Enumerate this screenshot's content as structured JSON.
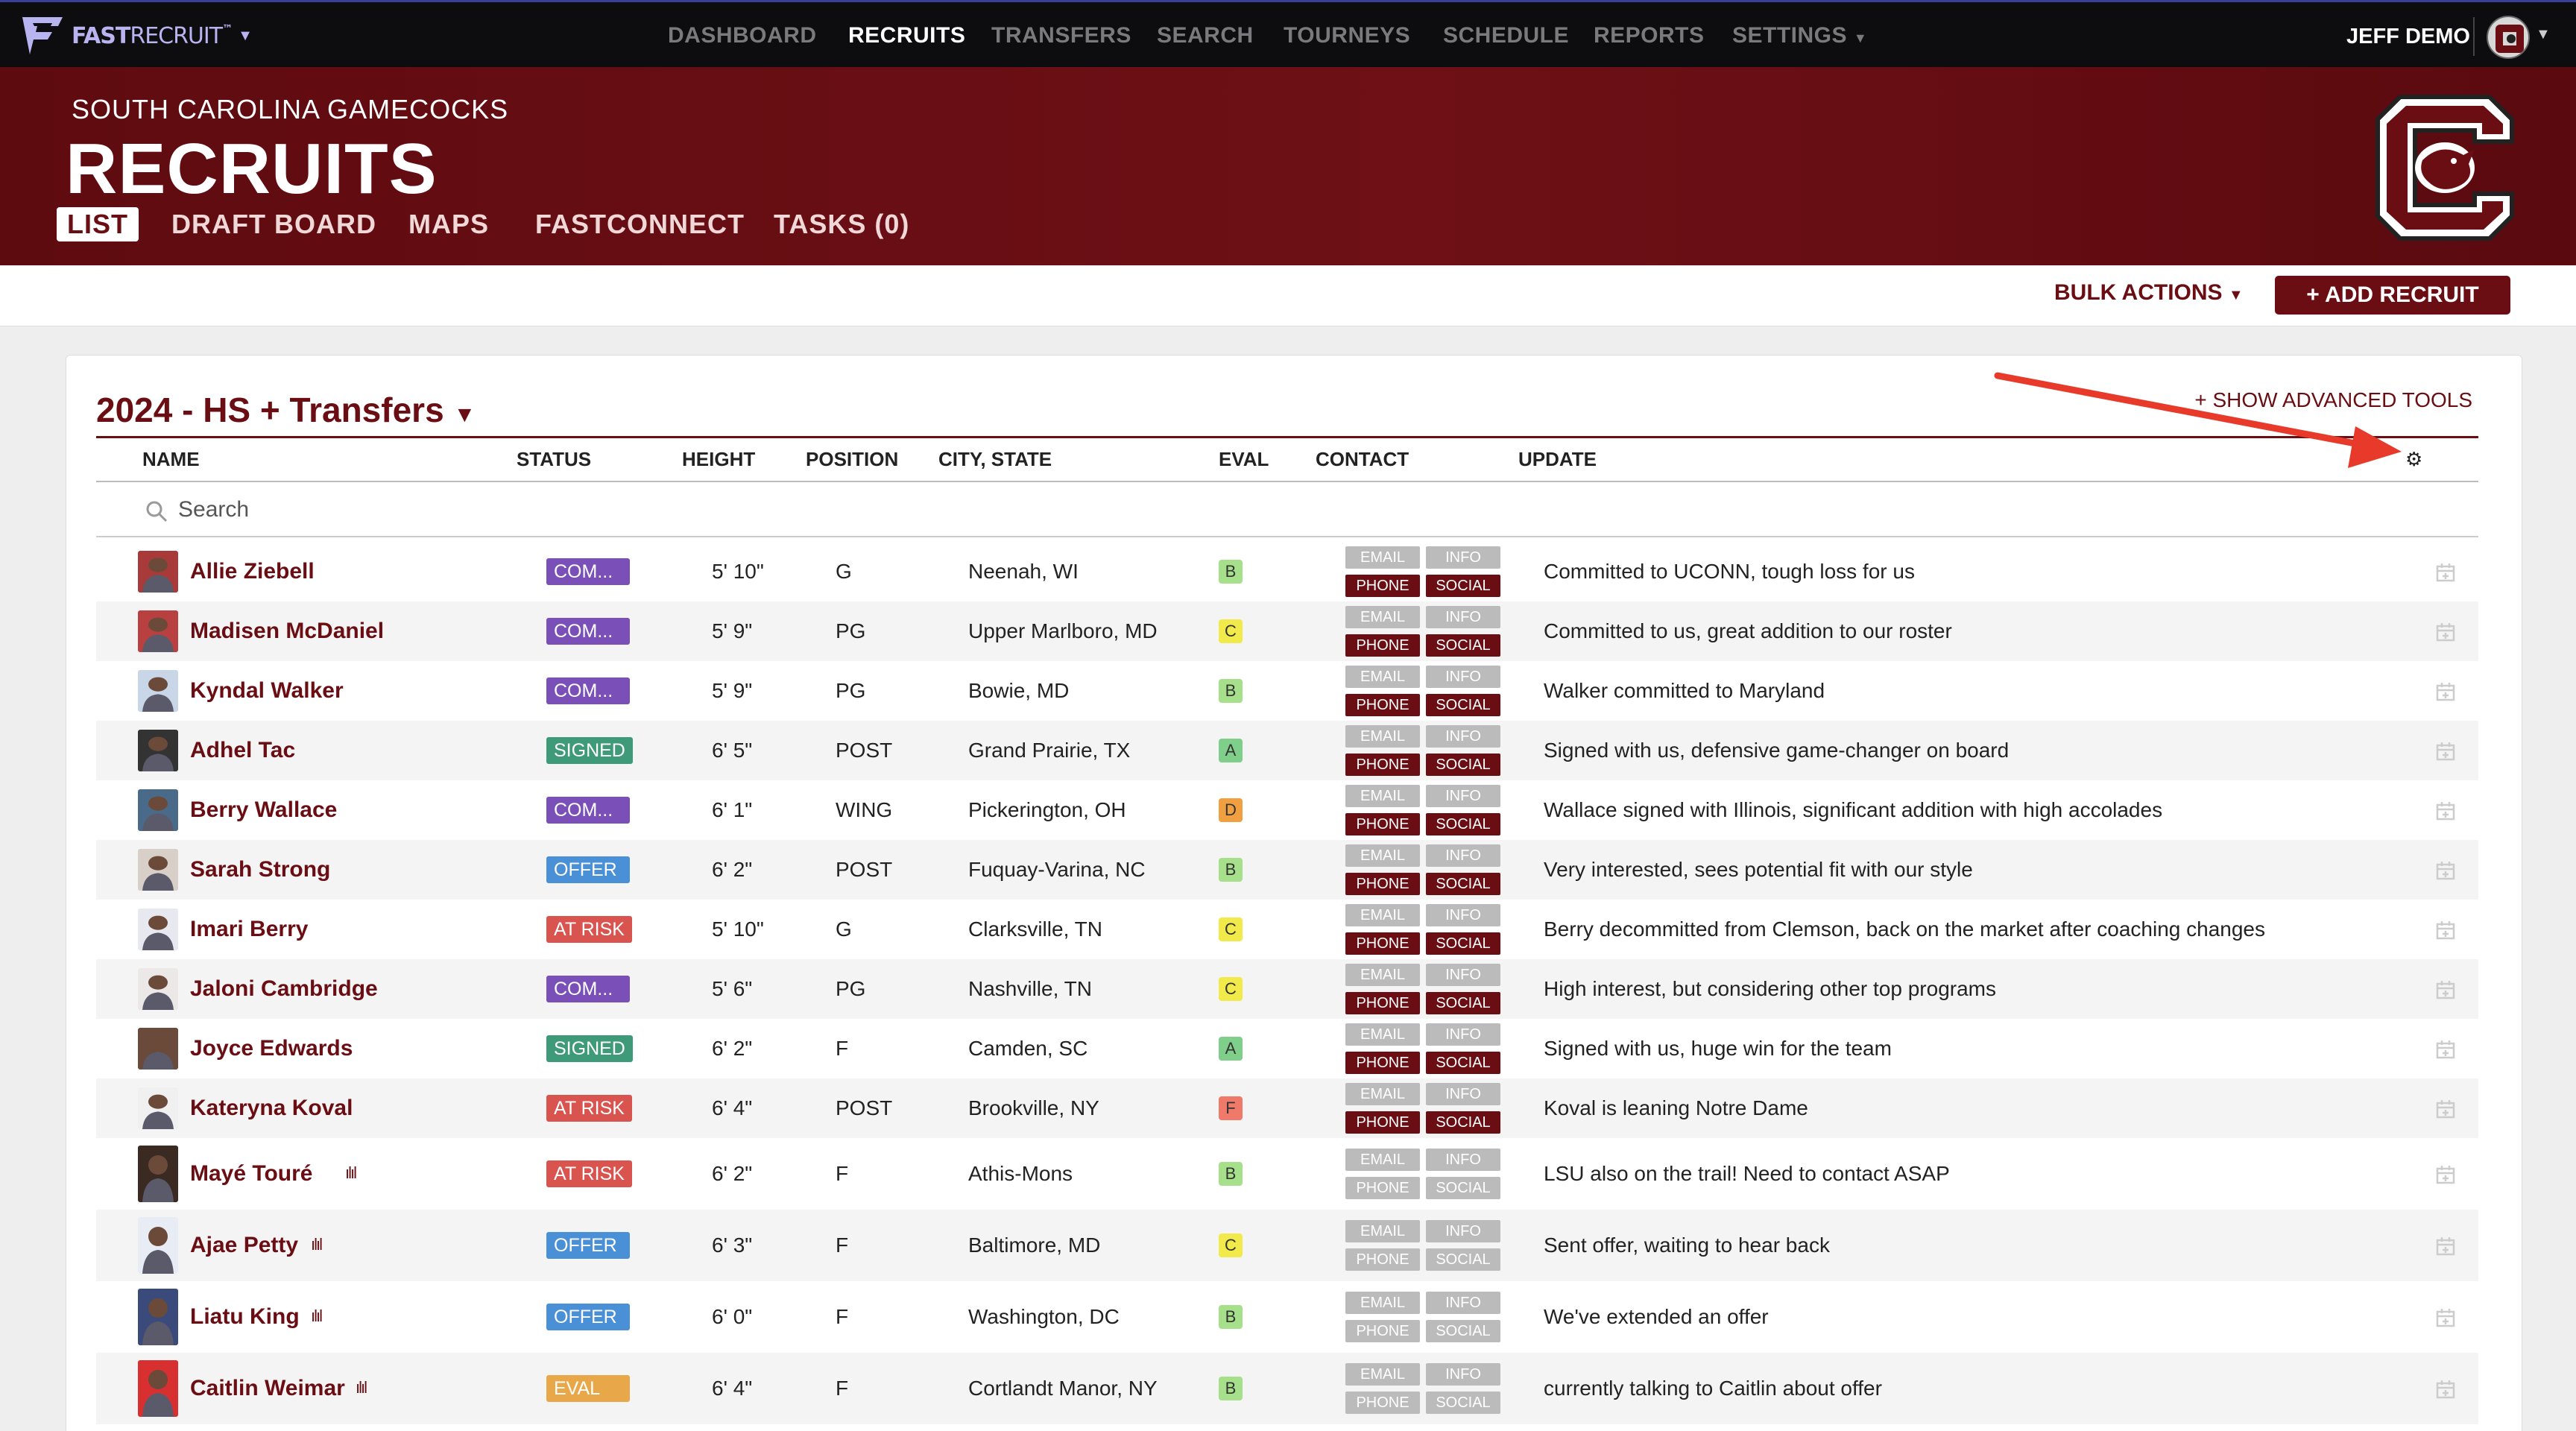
{
  "nav": {
    "logo_bold": "FAST",
    "logo_light": "RECRUIT",
    "logo_tm": "™",
    "links": [
      "DASHBOARD",
      "RECRUITS",
      "TRANSFERS",
      "SEARCH",
      "TOURNEYS",
      "SCHEDULE",
      "REPORTS",
      "SETTINGS"
    ],
    "active": "RECRUITS",
    "user": "JEFF DEMO"
  },
  "header": {
    "team": "SOUTH CAROLINA GAMECOCKS",
    "title": "RECRUITS",
    "tabs": [
      "LIST",
      "DRAFT BOARD",
      "MAPS",
      "FASTCONNECT",
      "TASKS (0)"
    ],
    "active_tab": "LIST"
  },
  "actions": {
    "bulk": "BULK ACTIONS",
    "add": "+ ADD RECRUIT"
  },
  "list": {
    "title": "2024 - HS + Transfers",
    "advanced": "+ SHOW ADVANCED TOOLS",
    "columns": [
      "NAME",
      "STATUS",
      "HEIGHT",
      "POSITION",
      "CITY, STATE",
      "EVAL",
      "CONTACT",
      "UPDATE"
    ],
    "search_placeholder": "Search",
    "contact_labels": {
      "email": "EMAIL",
      "info": "INFO",
      "phone": "PHONE",
      "social": "SOCIAL"
    },
    "rows": [
      {
        "name": "Allie Ziebell",
        "status": "COM...",
        "height": "5' 10\"",
        "position": "G",
        "city": "Neenah, WI",
        "eval": "B",
        "update": "Committed to UCONN, tough loss for us",
        "bars": ""
      },
      {
        "name": "Madisen McDaniel",
        "status": "COM...",
        "height": "5' 9\"",
        "position": "PG",
        "city": "Upper Marlboro, MD",
        "eval": "C",
        "update": "Committed to us, great addition to our roster",
        "bars": ""
      },
      {
        "name": "Kyndal Walker",
        "status": "COM...",
        "height": "5' 9\"",
        "position": "PG",
        "city": "Bowie, MD",
        "eval": "B",
        "update": "Walker committed to Maryland",
        "bars": ""
      },
      {
        "name": "Adhel Tac",
        "status": "SIGNED",
        "height": "6' 5\"",
        "position": "POST",
        "city": "Grand Prairie, TX",
        "eval": "A",
        "update": "Signed with us, defensive game-changer on board",
        "bars": ""
      },
      {
        "name": "Berry Wallace",
        "status": "COM...",
        "height": "6' 1\"",
        "position": "WING",
        "city": "Pickerington, OH",
        "eval": "D",
        "update": "Wallace signed with Illinois, significant addition with high accolades",
        "bars": ""
      },
      {
        "name": "Sarah Strong",
        "status": "OFFER",
        "height": "6' 2\"",
        "position": "POST",
        "city": "Fuquay-Varina, NC",
        "eval": "B",
        "update": "Very interested, sees potential fit with our style",
        "bars": ""
      },
      {
        "name": "Imari Berry",
        "status": "AT RISK",
        "height": "5' 10\"",
        "position": "G",
        "city": "Clarksville, TN",
        "eval": "C",
        "update": "Berry decommitted from Clemson, back on the market after coaching changes",
        "bars": ""
      },
      {
        "name": "Jaloni Cambridge",
        "status": "COM...",
        "height": "5' 6\"",
        "position": "PG",
        "city": "Nashville, TN",
        "eval": "C",
        "update": "High interest, but considering other top programs",
        "bars": ""
      },
      {
        "name": "Joyce Edwards",
        "status": "SIGNED",
        "height": "6' 2\"",
        "position": "F",
        "city": "Camden, SC",
        "eval": "A",
        "update": "Signed with us, huge win for the team",
        "bars": ""
      },
      {
        "name": "Kateryna Koval",
        "status": "AT RISK",
        "height": "6' 4\"",
        "position": "POST",
        "city": "Brookville, NY",
        "eval": "F",
        "update": "Koval is leaning Notre Dame",
        "bars": ""
      },
      {
        "name": "Mayé Touré",
        "status": "AT RISK",
        "height": "6' 2\"",
        "position": "F",
        "city": "Athis-Mons",
        "eval": "B",
        "update": "LSU also on the trail! Need to contact ASAP",
        "bars": "ılıl"
      },
      {
        "name": "Ajae Petty",
        "status": "OFFER",
        "height": "6' 3\"",
        "position": "F",
        "city": "Baltimore, MD",
        "eval": "C",
        "update": "Sent offer, waiting to hear back",
        "bars": "ılıl"
      },
      {
        "name": "Liatu King",
        "status": "OFFER",
        "height": "6' 0\"",
        "position": "F",
        "city": "Washington, DC",
        "eval": "B",
        "update": "We've extended an offer",
        "bars": "ılıl"
      },
      {
        "name": "Caitlin Weimar",
        "status": "EVAL",
        "height": "6' 4\"",
        "position": "F",
        "city": "Cortlandt Manor, NY",
        "eval": "B",
        "update": "currently talking to Caitlin about offer",
        "bars": "ılıl"
      }
    ]
  },
  "colors": {
    "maroon": "#6a0e14",
    "status_committed": "#7b4fb8",
    "status_signed": "#3f9a7a",
    "status_offer": "#4a90d6",
    "status_atrisk": "#d9534f",
    "status_eval": "#e8a84a",
    "eval_A": "#7fcf8a",
    "eval_B": "#a6e08a",
    "eval_C": "#f1ea4a",
    "eval_D": "#f0a040",
    "eval_F": "#f07a6a",
    "annotation_arrow": "#e83a2a"
  }
}
